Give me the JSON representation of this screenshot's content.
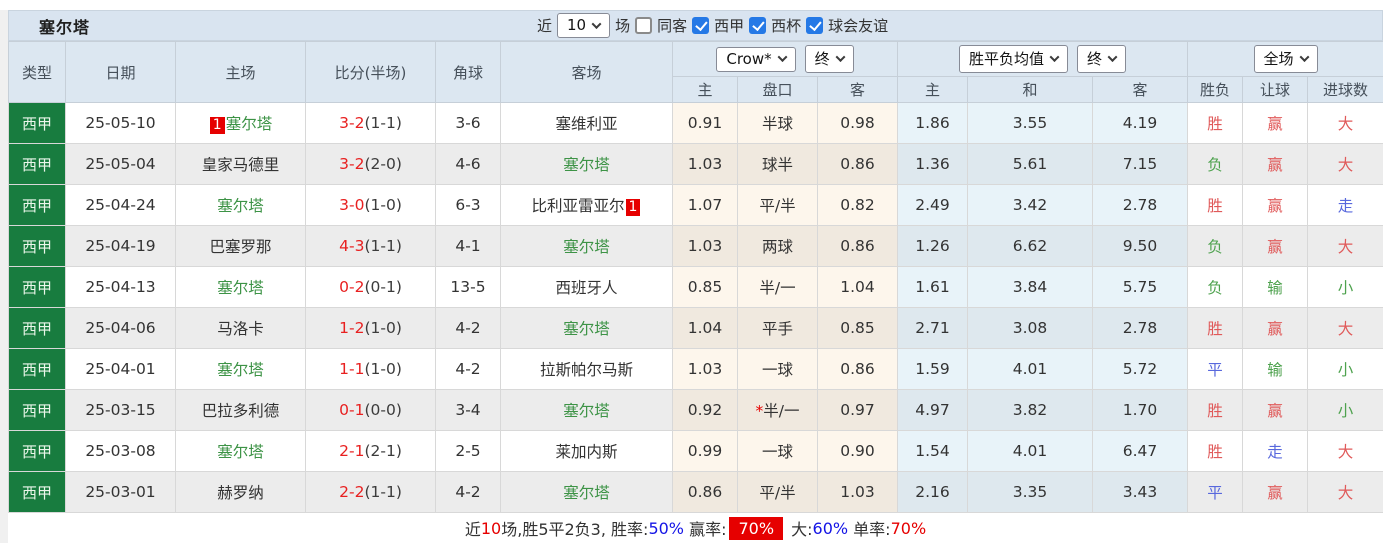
{
  "header": {
    "team_title": "塞尔塔",
    "filter": {
      "near_label": "近",
      "count": "10",
      "matches_label": "场",
      "same_opponent_label": "同客",
      "leagues": [
        {
          "label": "西甲",
          "checked": true
        },
        {
          "label": "西杯",
          "checked": true
        },
        {
          "label": "球会友谊",
          "checked": true
        }
      ]
    }
  },
  "table": {
    "head": {
      "type": "类型",
      "date": "日期",
      "home": "主场",
      "score": "比分(半场)",
      "corners": "角球",
      "away": "客场",
      "sub": [
        "主",
        "盘口",
        "客",
        "主",
        "和",
        "客",
        "胜负",
        "让球",
        "进球数"
      ]
    },
    "groups": {
      "crow": {
        "select_main": "Crow*",
        "select_time": "终"
      },
      "avg": {
        "select_main": "胜平负均值",
        "select_time": "终"
      },
      "full": {
        "select_main": "全场"
      }
    },
    "rows": [
      {
        "league": "西甲",
        "date": "25-05-10",
        "home": "塞尔塔",
        "home_green": true,
        "home_badge": "1",
        "away": "塞维利亚",
        "away_green": false,
        "away_badge": null,
        "score_ft": "3-2",
        "score_ht": "(1-1)",
        "corners": "3-6",
        "odds": {
          "home": "0.91",
          "line": "半球",
          "star": false,
          "away": "0.98"
        },
        "avg": [
          "1.86",
          "3.55",
          "4.19"
        ],
        "results": [
          {
            "text": "胜",
            "color": "red"
          },
          {
            "text": "赢",
            "color": "red"
          },
          {
            "text": "大",
            "color": "red"
          }
        ]
      },
      {
        "league": "西甲",
        "date": "25-05-04",
        "home": "皇家马德里",
        "home_green": false,
        "home_badge": null,
        "away": "塞尔塔",
        "away_green": true,
        "away_badge": null,
        "score_ft": "3-2",
        "score_ht": "(2-0)",
        "corners": "4-6",
        "odds": {
          "home": "1.03",
          "line": "球半",
          "star": false,
          "away": "0.86"
        },
        "avg": [
          "1.36",
          "5.61",
          "7.15"
        ],
        "results": [
          {
            "text": "负",
            "color": "green"
          },
          {
            "text": "赢",
            "color": "red"
          },
          {
            "text": "大",
            "color": "red"
          }
        ]
      },
      {
        "league": "西甲",
        "date": "25-04-24",
        "home": "塞尔塔",
        "home_green": true,
        "home_badge": null,
        "away": "比利亚雷亚尔",
        "away_green": false,
        "away_badge": "1",
        "score_ft": "3-0",
        "score_ht": "(1-0)",
        "corners": "6-3",
        "odds": {
          "home": "1.07",
          "line": "平/半",
          "star": false,
          "away": "0.82"
        },
        "avg": [
          "2.49",
          "3.42",
          "2.78"
        ],
        "results": [
          {
            "text": "胜",
            "color": "red"
          },
          {
            "text": "赢",
            "color": "red"
          },
          {
            "text": "走",
            "color": "blue"
          }
        ]
      },
      {
        "league": "西甲",
        "date": "25-04-19",
        "home": "巴塞罗那",
        "home_green": false,
        "home_badge": null,
        "away": "塞尔塔",
        "away_green": true,
        "away_badge": null,
        "score_ft": "4-3",
        "score_ht": "(1-1)",
        "corners": "4-1",
        "odds": {
          "home": "1.03",
          "line": "两球",
          "star": false,
          "away": "0.86"
        },
        "avg": [
          "1.26",
          "6.62",
          "9.50"
        ],
        "results": [
          {
            "text": "负",
            "color": "green"
          },
          {
            "text": "赢",
            "color": "red"
          },
          {
            "text": "大",
            "color": "red"
          }
        ]
      },
      {
        "league": "西甲",
        "date": "25-04-13",
        "home": "塞尔塔",
        "home_green": true,
        "home_badge": null,
        "away": "西班牙人",
        "away_green": false,
        "away_badge": null,
        "score_ft": "0-2",
        "score_ht": "(0-1)",
        "corners": "13-5",
        "odds": {
          "home": "0.85",
          "line": "半/一",
          "star": false,
          "away": "1.04"
        },
        "avg": [
          "1.61",
          "3.84",
          "5.75"
        ],
        "results": [
          {
            "text": "负",
            "color": "green"
          },
          {
            "text": "输",
            "color": "green"
          },
          {
            "text": "小",
            "color": "green"
          }
        ]
      },
      {
        "league": "西甲",
        "date": "25-04-06",
        "home": "马洛卡",
        "home_green": false,
        "home_badge": null,
        "away": "塞尔塔",
        "away_green": true,
        "away_badge": null,
        "score_ft": "1-2",
        "score_ht": "(1-0)",
        "corners": "4-2",
        "odds": {
          "home": "1.04",
          "line": "平手",
          "star": false,
          "away": "0.85"
        },
        "avg": [
          "2.71",
          "3.08",
          "2.78"
        ],
        "results": [
          {
            "text": "胜",
            "color": "red"
          },
          {
            "text": "赢",
            "color": "red"
          },
          {
            "text": "大",
            "color": "red"
          }
        ]
      },
      {
        "league": "西甲",
        "date": "25-04-01",
        "home": "塞尔塔",
        "home_green": true,
        "home_badge": null,
        "away": "拉斯帕尔马斯",
        "away_green": false,
        "away_badge": null,
        "score_ft": "1-1",
        "score_ht": "(1-0)",
        "corners": "4-2",
        "odds": {
          "home": "1.03",
          "line": "一球",
          "star": false,
          "away": "0.86"
        },
        "avg": [
          "1.59",
          "4.01",
          "5.72"
        ],
        "results": [
          {
            "text": "平",
            "color": "blue"
          },
          {
            "text": "输",
            "color": "green"
          },
          {
            "text": "小",
            "color": "green"
          }
        ]
      },
      {
        "league": "西甲",
        "date": "25-03-15",
        "home": "巴拉多利德",
        "home_green": false,
        "home_badge": null,
        "away": "塞尔塔",
        "away_green": true,
        "away_badge": null,
        "score_ft": "0-1",
        "score_ht": "(0-0)",
        "corners": "3-4",
        "odds": {
          "home": "0.92",
          "line": "半/一",
          "star": true,
          "away": "0.97"
        },
        "avg": [
          "4.97",
          "3.82",
          "1.70"
        ],
        "results": [
          {
            "text": "胜",
            "color": "red"
          },
          {
            "text": "赢",
            "color": "red"
          },
          {
            "text": "小",
            "color": "green"
          }
        ]
      },
      {
        "league": "西甲",
        "date": "25-03-08",
        "home": "塞尔塔",
        "home_green": true,
        "home_badge": null,
        "away": "莱加内斯",
        "away_green": false,
        "away_badge": null,
        "score_ft": "2-1",
        "score_ht": "(2-1)",
        "corners": "2-5",
        "odds": {
          "home": "0.99",
          "line": "一球",
          "star": false,
          "away": "0.90"
        },
        "avg": [
          "1.54",
          "4.01",
          "6.47"
        ],
        "results": [
          {
            "text": "胜",
            "color": "red"
          },
          {
            "text": "走",
            "color": "blue"
          },
          {
            "text": "大",
            "color": "red"
          }
        ]
      },
      {
        "league": "西甲",
        "date": "25-03-01",
        "home": "赫罗纳",
        "home_green": false,
        "home_badge": null,
        "away": "塞尔塔",
        "away_green": true,
        "away_badge": null,
        "score_ft": "2-2",
        "score_ht": "(1-1)",
        "corners": "4-2",
        "odds": {
          "home": "0.86",
          "line": "平/半",
          "star": false,
          "away": "1.03"
        },
        "avg": [
          "2.16",
          "3.35",
          "3.43"
        ],
        "results": [
          {
            "text": "平",
            "color": "blue"
          },
          {
            "text": "赢",
            "color": "red"
          },
          {
            "text": "大",
            "color": "red"
          }
        ]
      }
    ]
  },
  "summary": {
    "segments": [
      {
        "text": "近",
        "style": "normal"
      },
      {
        "text": "10",
        "style": "red"
      },
      {
        "text": "场,胜5平2负3, 胜率:",
        "style": "normal"
      },
      {
        "text": "50%",
        "style": "blue"
      },
      {
        "text": " 赢率:",
        "style": "normal"
      },
      {
        "text": "70%",
        "style": "redbox"
      },
      {
        "text": " 大:",
        "style": "normal"
      },
      {
        "text": "60%",
        "style": "blue"
      },
      {
        "text": " 单率:",
        "style": "normal"
      },
      {
        "text": "70%",
        "style": "red"
      }
    ]
  }
}
